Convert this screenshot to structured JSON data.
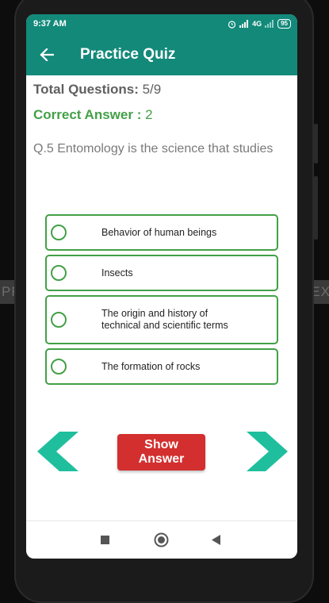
{
  "background": {
    "prev_label": "PREV",
    "next_label": "NEXT"
  },
  "status_bar": {
    "time": "9:37 AM",
    "network": "4G",
    "battery": "95"
  },
  "toolbar": {
    "title": "Practice Quiz"
  },
  "quiz": {
    "total_label": "Total Questions:",
    "total_value": "5/9",
    "correct_label": "Correct Answer :",
    "correct_value": "2",
    "question": "Q.5 Entomology is the science that studies",
    "options": [
      {
        "line1": "Behavior of human beings",
        "line2": ""
      },
      {
        "line1": "Insects",
        "line2": ""
      },
      {
        "line1": "The origin and history of",
        "line2": "technical and scientific terms"
      },
      {
        "line1": "The formation of rocks",
        "line2": ""
      }
    ]
  },
  "actions": {
    "show_answer": "Show Answer"
  },
  "colors": {
    "primary": "#13897a",
    "option_green": "#43a047",
    "arrow_teal": "#1fbf9e",
    "danger": "#d32f2f"
  }
}
